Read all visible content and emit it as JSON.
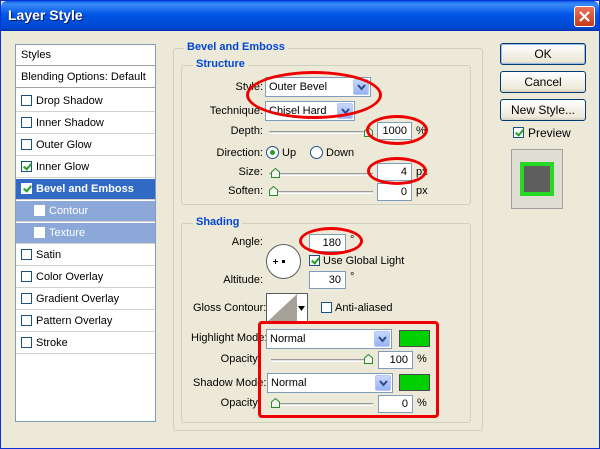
{
  "window": {
    "title": "Layer Style"
  },
  "styles_list": {
    "items": [
      {
        "label": "Styles"
      },
      {
        "label": "Blending Options: Default"
      },
      {
        "label": "Drop Shadow"
      },
      {
        "label": "Inner Shadow"
      },
      {
        "label": "Outer Glow"
      },
      {
        "label": "Inner Glow"
      },
      {
        "label": "Bevel and Emboss"
      },
      {
        "label": "Contour"
      },
      {
        "label": "Texture"
      },
      {
        "label": "Satin"
      },
      {
        "label": "Color Overlay"
      },
      {
        "label": "Gradient Overlay"
      },
      {
        "label": "Pattern Overlay"
      },
      {
        "label": "Stroke"
      }
    ]
  },
  "bevel": {
    "title": "Bevel and Emboss",
    "structure": {
      "title": "Structure",
      "style_label": "Style:",
      "style_value": "Outer Bevel",
      "technique_label": "Technique:",
      "technique_value": "Chisel Hard",
      "depth_label": "Depth:",
      "depth_value": "1000",
      "depth_unit": "%",
      "depth_fraction": 1.0,
      "direction_label": "Direction:",
      "direction_up": "Up",
      "direction_down": "Down",
      "size_label": "Size:",
      "size_value": "4",
      "size_unit": "px",
      "size_fraction": 0.02,
      "soften_label": "Soften:",
      "soften_value": "0",
      "soften_unit": "px",
      "soften_fraction": 0.0
    },
    "shading": {
      "title": "Shading",
      "angle_label": "Angle:",
      "angle_value": "180",
      "angle_unit": "°",
      "use_global_light": "Use Global Light",
      "altitude_label": "Altitude:",
      "altitude_value": "30",
      "altitude_unit": "°",
      "gloss_contour_label": "Gloss Contour:",
      "anti_aliased": "Anti-aliased",
      "highlight_mode_label": "Highlight Mode:",
      "highlight_mode_value": "Normal",
      "highlight_opacity_label": "Opacity:",
      "highlight_opacity_value": "100",
      "highlight_opacity_unit": "%",
      "highlight_opacity_fraction": 1.0,
      "shadow_mode_label": "Shadow Mode:",
      "shadow_mode_value": "Normal",
      "shadow_opacity_label": "Opacity:",
      "shadow_opacity_value": "0",
      "shadow_opacity_unit": "%",
      "shadow_opacity_fraction": 0.0
    }
  },
  "buttons": {
    "ok": "OK",
    "cancel": "Cancel",
    "new_style": "New Style...",
    "preview": "Preview"
  },
  "colors": {
    "highlight": "#00d000",
    "shadow": "#00d000",
    "accent": "#316ac5",
    "annotation": "#ee0000"
  }
}
